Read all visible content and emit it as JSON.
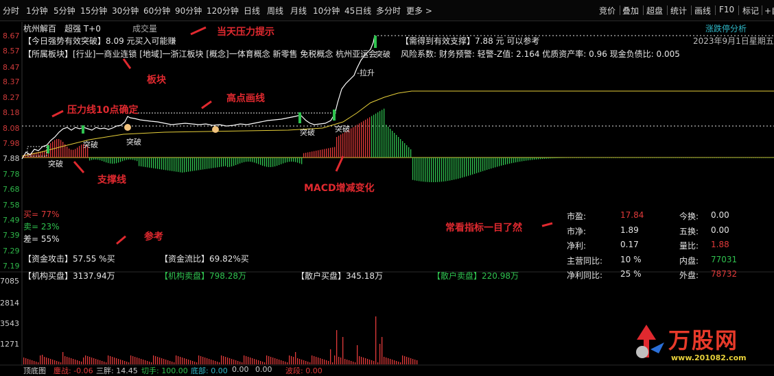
{
  "period_tabs": [
    "分时",
    "1分钟",
    "5分钟",
    "15分钟",
    "30分钟",
    "60分钟",
    "90分钟",
    "120分钟",
    "日线",
    "周线",
    "月线",
    "10分钟",
    "45日线",
    "多分时",
    "更多 >"
  ],
  "right_tabs": [
    "竞价",
    "叠加",
    "超盘",
    "统计",
    "画线",
    "F10",
    "标记",
    "+自"
  ],
  "stock": {
    "name": "杭州解百",
    "tag": "超强 T+0",
    "volume_label": "成交量"
  },
  "header_right": {
    "panel": "涨跌停分析",
    "date": "2023年9月1日星期五"
  },
  "y_prices": [
    "8.67",
    "8.57",
    "8.47",
    "8.37",
    "8.27",
    "8.18",
    "8.08",
    "7.98",
    "7.88",
    "7.78",
    "7.68",
    "7.58",
    "7.49",
    "7.39",
    "7.29",
    "7.19"
  ],
  "y_volume": [
    "7085",
    "2814",
    "3543",
    "1271"
  ],
  "info": {
    "line1_key": "【今日强势有效突破】",
    "line1_val": "8.09 元买入可能赚",
    "line1b_key": "【需得到有效支撑】",
    "line1b_val": "7.88 元 可以参考",
    "sector_key": "【所属板块】",
    "sector_val": "[行业]一商业连锁 [地域]一浙江板块 [概念]一体育概念 新零售 免税概念 杭州亚运会",
    "risk_val": "风险系数: 财务预警: 轻警-Z值: 2.164 优质资产率: 0.96 现金负债比: 0.005"
  },
  "breakouts": [
    "突破",
    "突破",
    "突破",
    "突破",
    "突破",
    "突破"
  ],
  "lift_label": "-拉升",
  "ratios": {
    "buy": "买= 77%",
    "sell": "卖= 23%",
    "diff": "差= 55%"
  },
  "capital": {
    "attack_key": "【资金攻击】",
    "attack_val": "57.55 %买",
    "flow_key": "【资金流比】",
    "flow_val": "69.82%买"
  },
  "orders": {
    "inst_buy_key": "【机构买盘】",
    "inst_buy_val": "3137.94万",
    "inst_sell_key": "【机构卖盘】",
    "inst_sell_val": "798.28万",
    "retail_buy_key": "【散户买盘】",
    "retail_buy_val": "345.18万",
    "retail_sell_key": "【散户卖盘】",
    "retail_sell_val": "220.98万"
  },
  "fin": {
    "pe_k": "市盈:",
    "pe_v": "17.84",
    "pb_k": "市净:",
    "pb_v": "1.89",
    "np_k": "净利:",
    "np_v": "0.17",
    "rev_k": "主营同比:",
    "rev_v": "10 %",
    "npg_k": "净利同比:",
    "npg_v": "25 %",
    "to_k": "今换:",
    "to_v": "0.00",
    "wh_k": "五换:",
    "wh_v": "0.00",
    "vr_k": "量比:",
    "vr_v": "1.88",
    "in_k": "内盘:",
    "in_v": "77031",
    "out_k": "外盘:",
    "out_v": "78732"
  },
  "annotations": {
    "pressure_today": "当天压力提示",
    "sector": "板块",
    "high_line": "高点画线",
    "pressure_10": "压力线10点确定",
    "support": "支撑线",
    "macd": "MACD增减变化",
    "reference": "参考",
    "indicators": "常看指标一目了然"
  },
  "bottom": {
    "bottom_chart": "顶底图",
    "battle": "鏖战: -0.06",
    "three": "三胖: 14.45",
    "cut": "切手: 100.00",
    "floor": "底部: 0.00",
    "zero1": "0.00",
    "zero2": "0.00",
    "wave": "波段: 0.00"
  },
  "watermark": {
    "brand": "万股网",
    "url": "www.201082.com"
  },
  "colors": {
    "up": "#e23a3a",
    "down": "#2fc24f",
    "price_line": "#ffffff",
    "avg_line": "#e8d13a",
    "annotation": "#e0292f"
  }
}
